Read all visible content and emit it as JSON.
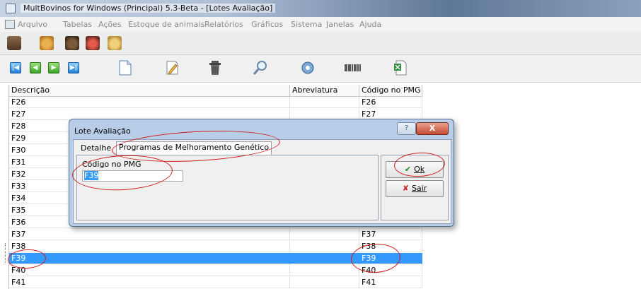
{
  "window": {
    "title": "MultBovinos for Windows (Principal) 5.3-Beta - [Lotes Avaliação]"
  },
  "menu": [
    "Arquivo",
    "Tabelas",
    "Ações",
    "Estoque de animais",
    "Relatórios",
    "Gráficos",
    "Sistema",
    "Janelas",
    "Ajuda"
  ],
  "quickbar_icons": [
    "exit-icon",
    "bull-icon",
    "bull-dark-icon",
    "cow-red-icon",
    "calf-icon"
  ],
  "toolbar_icons": [
    "first-record-icon",
    "previous-record-icon",
    "next-record-icon",
    "last-record-icon",
    "new-document-icon",
    "edit-icon",
    "trash-icon",
    "search-icon",
    "settings-icon",
    "barcode-icon",
    "excel-icon"
  ],
  "grid": {
    "headers": [
      "Descrição",
      "Abreviatura",
      "Código no PMG"
    ],
    "rows": [
      [
        "F26",
        "",
        "F26"
      ],
      [
        "F27",
        "",
        "F27"
      ],
      [
        "F28",
        "",
        ""
      ],
      [
        "F29",
        "",
        ""
      ],
      [
        "F30",
        "",
        ""
      ],
      [
        "F31",
        "",
        ""
      ],
      [
        "F32",
        "",
        ""
      ],
      [
        "F33",
        "",
        ""
      ],
      [
        "F34",
        "",
        ""
      ],
      [
        "F35",
        "",
        ""
      ],
      [
        "F36",
        "",
        ""
      ],
      [
        "F37",
        "",
        "F37"
      ],
      [
        "F38",
        "",
        "F38"
      ],
      [
        "F39",
        "",
        "F39"
      ],
      [
        "F40",
        "",
        "F40"
      ],
      [
        "F41",
        "",
        "F41"
      ]
    ],
    "selected_row": "F39"
  },
  "dialog": {
    "title": "Lote Avaliação",
    "help": "?",
    "close": "X",
    "tabs": [
      "Detalhe",
      "Programas de Melhoramento Genético"
    ],
    "active_tab": "Programas de Melhoramento Genético",
    "field_label": "Código no PMG",
    "field_value": "F39",
    "ok_label": "Ok",
    "sair_label": "Sair"
  },
  "colors": {
    "selection": "#3399ff",
    "annotation": "#d11a1a",
    "dialog_frame": "#b8cee8"
  }
}
